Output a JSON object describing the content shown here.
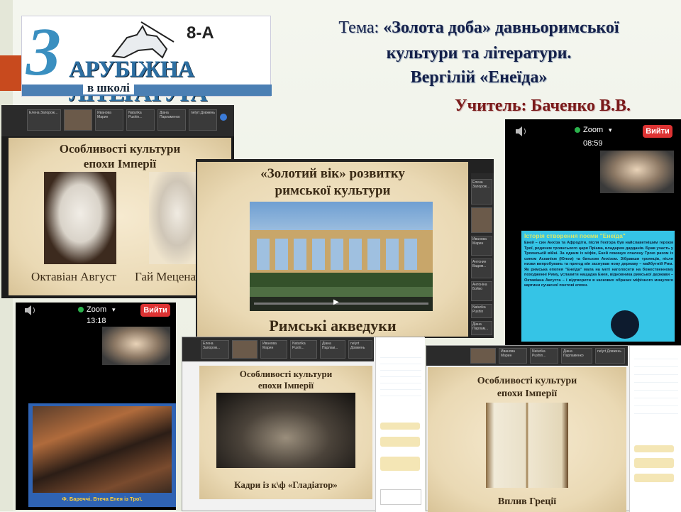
{
  "header": {
    "class_badge": "8-А",
    "logo_title": "АРУБІЖНА ЛІТЕРАТУРА",
    "logo_letter": "З",
    "logo_sub": "в школі",
    "topic_prefix": "Тема:",
    "topic_line1": "«Золота  доба» давньоримської",
    "topic_line2": "культури та літератури.",
    "topic_line3": "Вергілій «Енеїда»",
    "teacher": "Учитель: Баченко В.В."
  },
  "screens": {
    "empire_top": {
      "title1": "Особливості культури",
      "title2": "епохи Імперії",
      "caption_left": "Октавіан Август",
      "caption_right": "Гай Меценат",
      "participants": [
        "Елена Запорож...",
        "Иванова Марин",
        "Naturika Pushin...",
        "Діана Парламенко",
        "nelyrt Довжень"
      ]
    },
    "aqueduct": {
      "title1": "«Золотий вік» розвитку",
      "title2": "римської культури",
      "caption": "Римські акведуки",
      "participants": [
        "Елена Запорож...",
        "Иванова Марин",
        "Антонин Вадим...",
        "Антоніна Бойко",
        "Naturika Pushin",
        "Діана Парлам..."
      ]
    },
    "phone_right": {
      "app": "Zoom",
      "exit": "Вийти",
      "time": "08:59",
      "slide_title": "Історія створення поеми \"Енеїда\"",
      "slide_text": "Еней – син Анхіза та Афродіти, після Гектора був найславетнішим героєм Трої, родичем троянського царя Пріама, владарем дарданів. Брав участь у Троянській війні. За одним із міфів, Еней покинув спалену Трою разом із сином Асканієм (Юлом) та батьком Анхізом. Зібравши троянців, після низки випробувань та пригод він заснував нову державу – майбутній Рим. Як римська епопея \"Енеїда\" мала на меті наголосити на божественному походженні Риму, уславити нащадка Енея, відновника римської держави – Октавіана Августа – і відтворити в казкових образах міфічного минулого картини сучасної поетові епохи."
    },
    "phone_left": {
      "app": "Zoom",
      "exit": "Вийти",
      "time": "13:18",
      "slide_caption": "Ф. Бароччі. Втеча Енея із Трої."
    },
    "gladiator": {
      "title1": "Особливості культури",
      "title2": "епохи Імперії",
      "caption": "Кадри із к\\ф «Гладіатор»",
      "participants": [
        "Елена Запорож...",
        "Иванова Марин",
        "Naturika Pushi...",
        "Діана Парлам...",
        "nelyrt Довжень"
      ]
    },
    "greece": {
      "title1": "Особливості культури",
      "title2": "епохи Імперії",
      "caption": "Вплив Греції",
      "participants": [
        "Иванова Марин",
        "Naturika Pushin...",
        "Діана Парламенко",
        "nelyrt Довжень"
      ]
    }
  },
  "colors": {
    "accent_red": "#c84a1e",
    "title_navy": "#14204a",
    "teacher_red": "#7a1a1a",
    "slide_cyan": "#35c4e6"
  }
}
